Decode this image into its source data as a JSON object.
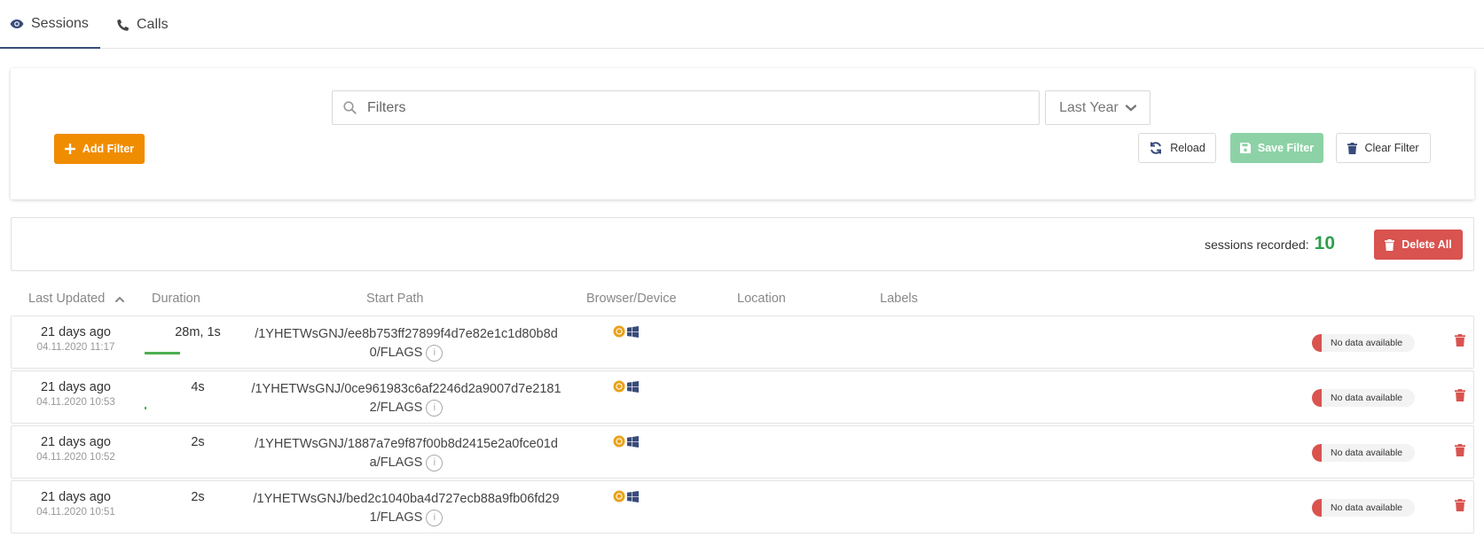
{
  "tabs": [
    {
      "label": "Sessions",
      "icon": "eye-icon",
      "active": true
    },
    {
      "label": "Calls",
      "icon": "phone-icon",
      "active": false
    }
  ],
  "filters": {
    "search_placeholder": "Filters",
    "period": "Last Year",
    "add_filter": "Add Filter",
    "reload": "Reload",
    "save_filter": "Save Filter",
    "clear_filter": "Clear Filter"
  },
  "summary": {
    "label": "sessions recorded:",
    "count": "10",
    "delete_all": "Delete All"
  },
  "columns": {
    "last_updated": "Last Updated",
    "duration": "Duration",
    "start_path": "Start Path",
    "browser_device": "Browser/Device",
    "location": "Location",
    "labels": "Labels"
  },
  "rows": [
    {
      "ago": "21 days ago",
      "date": "04.11.2020 11:17",
      "duration": "28m, 1s",
      "duration_fraction": 0.5,
      "path": "/1YHETWsGNJ/ee8b753ff27899f4d7e82e1c1d80b8d0/FLAGS",
      "label": "No data available"
    },
    {
      "ago": "21 days ago",
      "date": "04.11.2020 10:53",
      "duration": "4s",
      "duration_fraction": 0.02,
      "path": "/1YHETWsGNJ/0ce961983c6af2246d2a9007d7e21812/FLAGS",
      "label": "No data available"
    },
    {
      "ago": "21 days ago",
      "date": "04.11.2020 10:52",
      "duration": "2s",
      "duration_fraction": 0.0,
      "path": "/1YHETWsGNJ/1887a7e9f87f00b8d2415e2a0fce01da/FLAGS",
      "label": "No data available"
    },
    {
      "ago": "21 days ago",
      "date": "04.11.2020 10:51",
      "duration": "2s",
      "duration_fraction": 0.0,
      "path": "/1YHETWsGNJ/bed2c1040ba4d727ecb88a9fb06fd291/FLAGS",
      "label": "No data available"
    }
  ],
  "colors": {
    "accent": "#394b7a",
    "add_filter": "#f08c00",
    "save_filter": "#8dd2a6",
    "delete": "#d9534f",
    "count": "#2e9e4f",
    "duration_bar": "#4caf50"
  }
}
